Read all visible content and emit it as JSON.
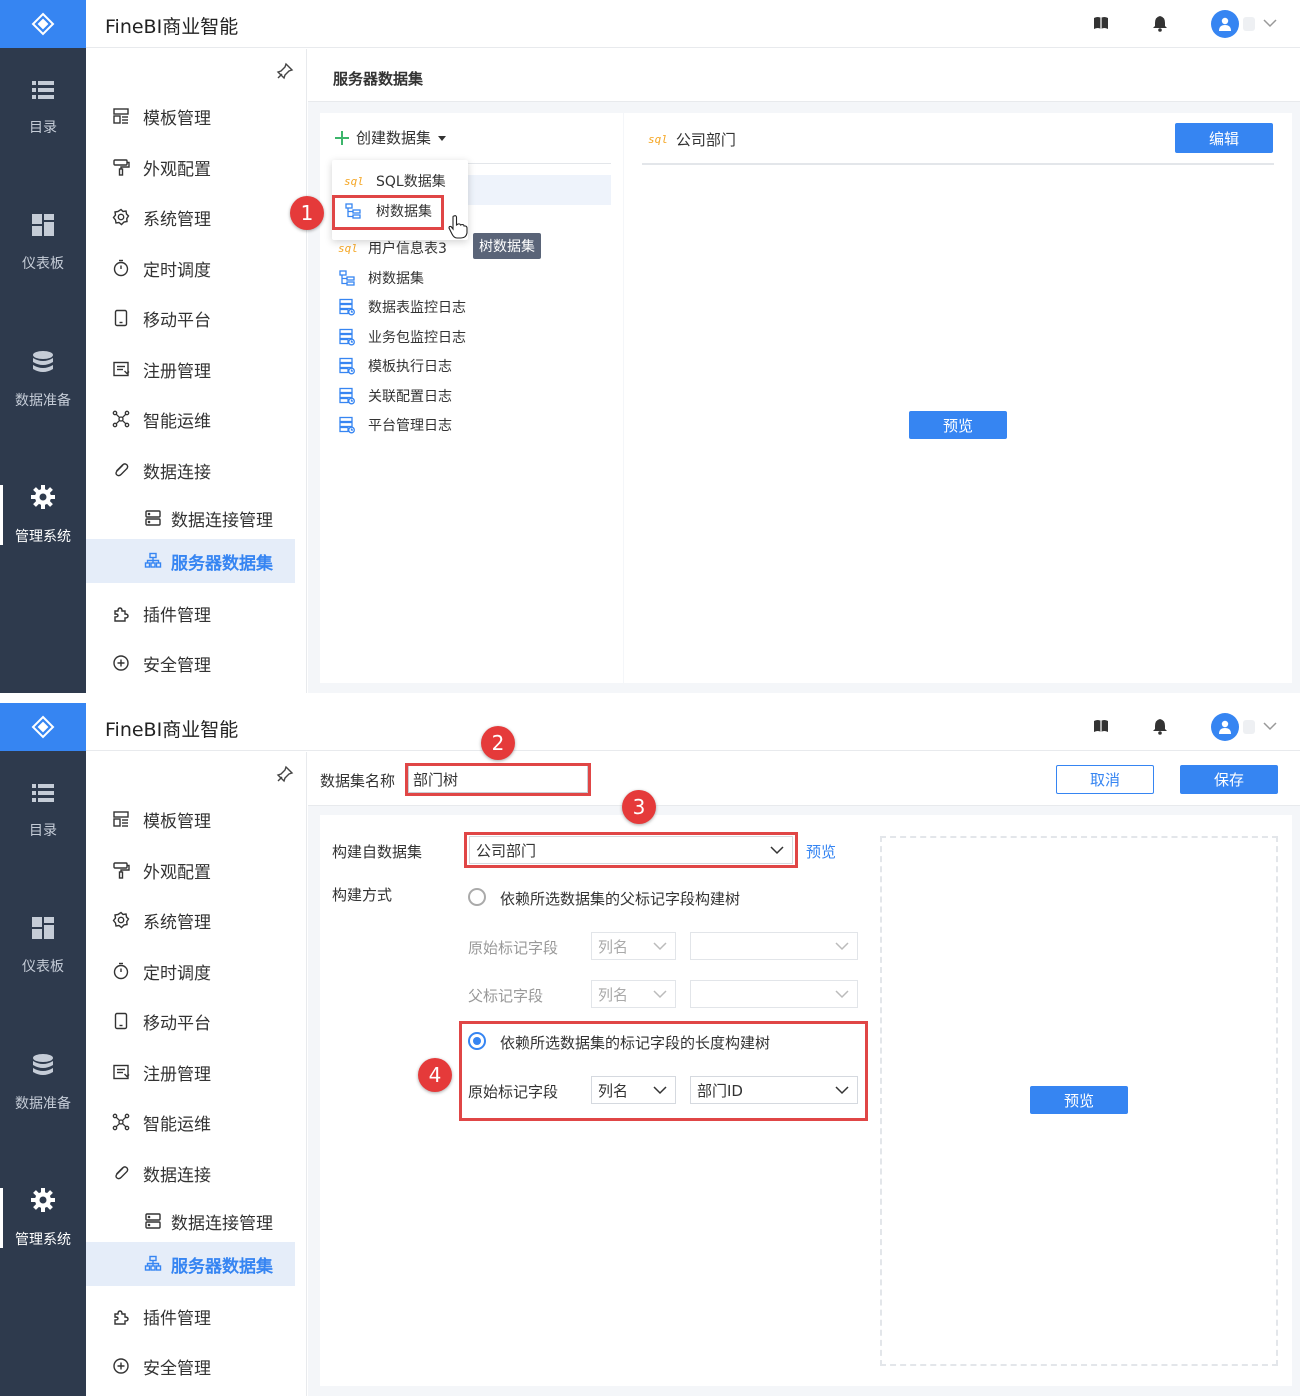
{
  "app": {
    "title": "FineBI商业智能"
  },
  "rail": [
    {
      "label": "目录",
      "icon": "list-icon"
    },
    {
      "label": "仪表板",
      "icon": "dashboard-icon"
    },
    {
      "label": "数据准备",
      "icon": "database-icon"
    },
    {
      "label": "管理系统",
      "icon": "gear-icon",
      "active": true
    }
  ],
  "menu": [
    {
      "label": "模板管理",
      "icon": "template-icon"
    },
    {
      "label": "外观配置",
      "icon": "brush-icon"
    },
    {
      "label": "系统管理",
      "icon": "settings-icon"
    },
    {
      "label": "定时调度",
      "icon": "timer-icon"
    },
    {
      "label": "移动平台",
      "icon": "mobile-icon"
    },
    {
      "label": "注册管理",
      "icon": "register-icon"
    },
    {
      "label": "智能运维",
      "icon": "ops-icon"
    },
    {
      "label": "数据连接",
      "icon": "link-icon"
    },
    {
      "label": "数据连接管理",
      "icon": "server-icon",
      "sub": true
    },
    {
      "label": "服务器数据集",
      "icon": "dataset-tree-icon",
      "sub": true,
      "active": true
    },
    {
      "label": "插件管理",
      "icon": "plugin-icon"
    },
    {
      "label": "安全管理",
      "icon": "shield-icon"
    }
  ],
  "panel1": {
    "crumb": "服务器数据集",
    "create_label": "创建数据集",
    "dropdown": [
      {
        "label": "SQL数据集",
        "icon": "sql-icon",
        "icon_text": "sql"
      },
      {
        "label": "树数据集",
        "icon": "tree-icon"
      }
    ],
    "datasets": [
      {
        "label": "用户信息表3",
        "icon": "sql-icon",
        "icon_text": "sql"
      },
      {
        "label": "树数据集",
        "icon": "tree-icon"
      },
      {
        "label": "数据表监控日志",
        "icon": "table-log-icon"
      },
      {
        "label": "业务包监控日志",
        "icon": "table-log-icon"
      },
      {
        "label": "模板执行日志",
        "icon": "table-log-icon"
      },
      {
        "label": "关联配置日志",
        "icon": "table-log-icon"
      },
      {
        "label": "平台管理日志",
        "icon": "table-log-icon"
      }
    ],
    "tooltip": "树数据集",
    "detail_title": "公司部门",
    "detail_icon_text": "sql",
    "edit_label": "编辑",
    "preview_label": "预览"
  },
  "panel2": {
    "name_label": "数据集名称",
    "name_value": "部门树",
    "cancel_label": "取消",
    "save_label": "保存",
    "source_label": "构建自数据集",
    "source_value": "公司部门",
    "source_preview": "预览",
    "method_label": "构建方式",
    "option1": "依赖所选数据集的父标记字段构建树",
    "orig_field_label": "原始标记字段",
    "parent_field_label": "父标记字段",
    "colname_placeholder": "列名",
    "option2": "依赖所选数据集的标记字段的长度构建树",
    "orig_field_label2": "原始标记字段",
    "colname_value": "列名",
    "field_value": "部门ID",
    "preview_label": "预览"
  },
  "badges": [
    "1",
    "2",
    "3",
    "4"
  ],
  "colors": {
    "rail": "#2e3a4d",
    "accent": "#3685f2",
    "annotation": "#e04646"
  }
}
